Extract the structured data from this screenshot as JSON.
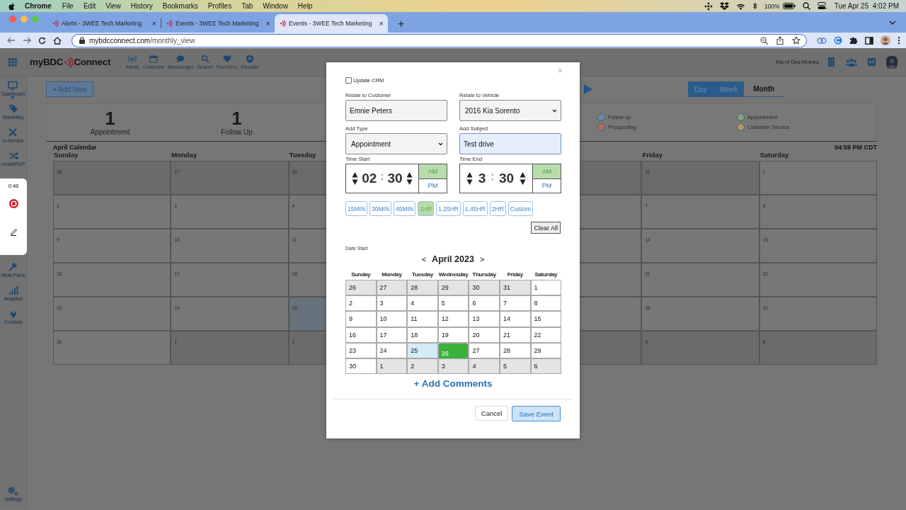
{
  "menu_bar": {
    "app": "Chrome",
    "items": [
      "File",
      "Edit",
      "View",
      "History",
      "Bookmarks",
      "Profiles",
      "Tab",
      "Window",
      "Help"
    ],
    "battery": "100%",
    "clock": "Tue Apr 25  4:02 PM"
  },
  "browser": {
    "tabs": [
      {
        "title": "Alerts - 3WEE Tech Marketing",
        "selected": false
      },
      {
        "title": "Events - 3WEE Tech Marketing",
        "selected": false
      },
      {
        "title": "Events - 3WEE Tech Marketing",
        "selected": true
      }
    ],
    "new_tab": "+",
    "close": "×",
    "url_host": "mybdcconnect.com",
    "url_path": "/monthly_view"
  },
  "app_header": {
    "logo_left": "myBDC",
    "logo_right": "Connect",
    "nav": [
      {
        "label": "Alerts",
        "disabled": false
      },
      {
        "label": "Calendar",
        "disabled": false
      },
      {
        "label": "Messenger",
        "disabled": false
      },
      {
        "label": "Search",
        "disabled": false
      },
      {
        "label": "Favorites",
        "disabled": true
      },
      {
        "label": "Recalls",
        "disabled": false
      }
    ],
    "dealer": "Kia of Des Moines"
  },
  "sidebar": {
    "items": [
      {
        "label": "Dashboard"
      },
      {
        "label": "Marketing"
      },
      {
        "label": "In-Service"
      },
      {
        "label": "Leads/FUP"
      },
      {
        "label": "Work Plans"
      },
      {
        "label": "Analytics"
      },
      {
        "label": "Contacts"
      }
    ],
    "settings": "Settings"
  },
  "recorder": {
    "time": "0:48"
  },
  "toolbar": {
    "add_button": "+ Add New",
    "views": [
      {
        "label": "Day",
        "selected": false
      },
      {
        "label": "Week",
        "selected": false
      },
      {
        "label": "Month",
        "selected": true
      }
    ]
  },
  "stats": [
    {
      "count": "1",
      "label": "Appointment"
    },
    {
      "count": "1",
      "label": "Follow Up"
    }
  ],
  "legend": [
    {
      "label": "Follow up",
      "color": "#6a8cad"
    },
    {
      "label": "Appointment",
      "color": "#7fa67c"
    },
    {
      "label": "Prospecting",
      "color": "#b06e68"
    },
    {
      "label": "Customer Service",
      "color": "#ad9670"
    }
  ],
  "calendar": {
    "title": "April Calendar",
    "time": "04:59 PM CDT",
    "headers": {
      "left": [
        "Sunday",
        "Monday",
        "Tuesday"
      ],
      "right": [
        "Friday",
        "Saturday"
      ]
    },
    "weeks": [
      {
        "left": [
          {
            "day": "26",
            "kind": "other"
          },
          {
            "day": "27",
            "kind": "other"
          },
          {
            "day": "28",
            "kind": "other"
          }
        ],
        "right": [
          {
            "day": "31",
            "kind": "other"
          },
          {
            "day": "1",
            "kind": "current"
          }
        ]
      },
      {
        "left": [
          {
            "day": "2",
            "kind": "current"
          },
          {
            "day": "3",
            "kind": "current"
          },
          {
            "day": "4",
            "kind": "current"
          }
        ],
        "right": [
          {
            "day": "7",
            "kind": "current"
          },
          {
            "day": "8",
            "kind": "current"
          }
        ]
      },
      {
        "left": [
          {
            "day": "9",
            "kind": "current"
          },
          {
            "day": "10",
            "kind": "current"
          },
          {
            "day": "11",
            "kind": "current"
          }
        ],
        "right": [
          {
            "day": "14",
            "kind": "current"
          },
          {
            "day": "15",
            "kind": "current"
          }
        ]
      },
      {
        "left": [
          {
            "day": "16",
            "kind": "current"
          },
          {
            "day": "17",
            "kind": "current"
          },
          {
            "day": "18",
            "kind": "current"
          }
        ],
        "right": [
          {
            "day": "21",
            "kind": "current"
          },
          {
            "day": "22",
            "kind": "current"
          }
        ]
      },
      {
        "left": [
          {
            "day": "23",
            "kind": "current"
          },
          {
            "day": "24",
            "kind": "current"
          },
          {
            "day": "25",
            "kind": "today"
          }
        ],
        "right": [
          {
            "day": "28",
            "kind": "current"
          },
          {
            "day": "29",
            "kind": "current"
          }
        ]
      },
      {
        "left": [
          {
            "day": "30",
            "kind": "current"
          },
          {
            "day": "1",
            "kind": "other"
          },
          {
            "day": "2",
            "kind": "other"
          }
        ],
        "right": [
          {
            "day": "5",
            "kind": "other"
          },
          {
            "day": "6",
            "kind": "other"
          }
        ]
      }
    ]
  },
  "modal": {
    "close": "×",
    "update_crm": {
      "label": "Update CRM",
      "checked": false
    },
    "customer": {
      "label": "Relate to Customer",
      "value": "Emnie Peters"
    },
    "vehicle": {
      "label": "Relate to Vehicle",
      "value": "2016 Kia Sorento"
    },
    "type": {
      "label": "Add Type",
      "value": "Appointment"
    },
    "subject": {
      "label": "Add Subject",
      "value": "Test drive"
    },
    "times": [
      {
        "label": "Time Start",
        "hour": "02",
        "separator": ":",
        "minute": "30",
        "periods": [
          {
            "label": "AM",
            "selected": true
          },
          {
            "label": "PM",
            "selected": false
          }
        ]
      },
      {
        "label": "Time End",
        "hour": "3",
        "separator": ":",
        "minute": "30",
        "periods": [
          {
            "label": "AM",
            "selected": true
          },
          {
            "label": "PM",
            "selected": false
          }
        ]
      }
    ],
    "durations": [
      {
        "label": "15MIN",
        "selected": false
      },
      {
        "label": "30MIN",
        "selected": false
      },
      {
        "label": "45MIN",
        "selected": false
      },
      {
        "label": "1HR",
        "selected": true
      },
      {
        "label": "1.25HR",
        "selected": false
      },
      {
        "label": "1.45HR",
        "selected": false
      },
      {
        "label": "2HR",
        "selected": false
      },
      {
        "label": "Custom",
        "selected": false
      }
    ],
    "clear_button": "Clear All",
    "date_label": "Date Start",
    "prev": "<",
    "month": "April 2023",
    "next": ">",
    "weekdays": [
      "Sunday",
      "Monday",
      "Tuesday",
      "Wednesday",
      "Thursday",
      "Friday",
      "Saturday"
    ],
    "weeks": [
      [
        {
          "day": "26",
          "kind": "other"
        },
        {
          "day": "27",
          "kind": "other"
        },
        {
          "day": "28",
          "kind": "other"
        },
        {
          "day": "29",
          "kind": "other"
        },
        {
          "day": "30",
          "kind": "other"
        },
        {
          "day": "31",
          "kind": "other"
        },
        {
          "day": "1",
          "kind": "current"
        }
      ],
      [
        {
          "day": "2",
          "kind": "current"
        },
        {
          "day": "3",
          "kind": "current"
        },
        {
          "day": "4",
          "kind": "current"
        },
        {
          "day": "5",
          "kind": "current"
        },
        {
          "day": "6",
          "kind": "current"
        },
        {
          "day": "7",
          "kind": "current"
        },
        {
          "day": "8",
          "kind": "current"
        }
      ],
      [
        {
          "day": "9",
          "kind": "current"
        },
        {
          "day": "10",
          "kind": "current"
        },
        {
          "day": "11",
          "kind": "current"
        },
        {
          "day": "12",
          "kind": "current"
        },
        {
          "day": "13",
          "kind": "current"
        },
        {
          "day": "14",
          "kind": "current"
        },
        {
          "day": "15",
          "kind": "current"
        }
      ],
      [
        {
          "day": "16",
          "kind": "current"
        },
        {
          "day": "17",
          "kind": "current"
        },
        {
          "day": "18",
          "kind": "current"
        },
        {
          "day": "19",
          "kind": "current"
        },
        {
          "day": "20",
          "kind": "current"
        },
        {
          "day": "21",
          "kind": "current"
        },
        {
          "day": "22",
          "kind": "current"
        }
      ],
      [
        {
          "day": "23",
          "kind": "current"
        },
        {
          "day": "24",
          "kind": "current"
        },
        {
          "day": "25",
          "kind": "today"
        },
        {
          "day": "26",
          "kind": "selected"
        },
        {
          "day": "27",
          "kind": "current"
        },
        {
          "day": "28",
          "kind": "current"
        },
        {
          "day": "29",
          "kind": "current"
        }
      ],
      [
        {
          "day": "30",
          "kind": "current"
        },
        {
          "day": "1",
          "kind": "other"
        },
        {
          "day": "2",
          "kind": "other"
        },
        {
          "day": "3",
          "kind": "other"
        },
        {
          "day": "4",
          "kind": "other"
        },
        {
          "day": "5",
          "kind": "other"
        },
        {
          "day": "6",
          "kind": "other"
        }
      ]
    ],
    "add_comments": "+ Add Comments",
    "cancel": "Cancel",
    "save": "Save Event"
  }
}
